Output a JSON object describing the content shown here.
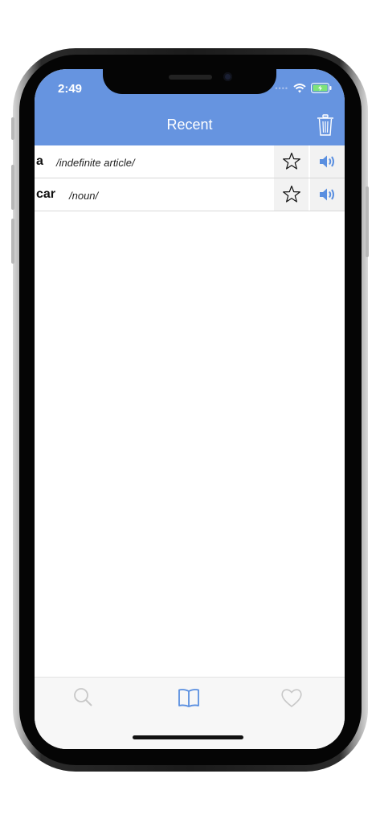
{
  "status_bar": {
    "time": "2:49",
    "signal_dots": "••••"
  },
  "header": {
    "title": "Recent",
    "delete_icon": "trash-icon"
  },
  "entries": [
    {
      "word": "a",
      "part_of_speech": "/indefinite article/"
    },
    {
      "word": "car",
      "part_of_speech": "/noun/"
    }
  ],
  "tabbar": {
    "items": [
      {
        "name": "search",
        "icon": "search-icon"
      },
      {
        "name": "dictionary",
        "icon": "book-icon",
        "active": true
      },
      {
        "name": "favorites",
        "icon": "heart-icon"
      }
    ]
  },
  "colors": {
    "header": "#6694e0",
    "accent": "#5a8fe0",
    "inactive_icon": "#c8c8c8",
    "battery": "#7ee37a"
  }
}
